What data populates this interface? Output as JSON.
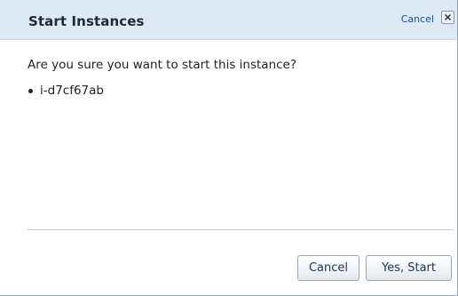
{
  "dialog": {
    "title": "Start Instances",
    "cancel_link": "Cancel",
    "close_icon": "close-icon",
    "message": "Are you sure you want to start this instance?",
    "instances": [
      "i-d7cf67ab"
    ],
    "buttons": {
      "cancel_label": "Cancel",
      "confirm_label": "Yes, Start"
    }
  },
  "colors": {
    "titlebar_bg": "#dde9f4",
    "link": "#1a4f9c",
    "text": "#222222"
  }
}
